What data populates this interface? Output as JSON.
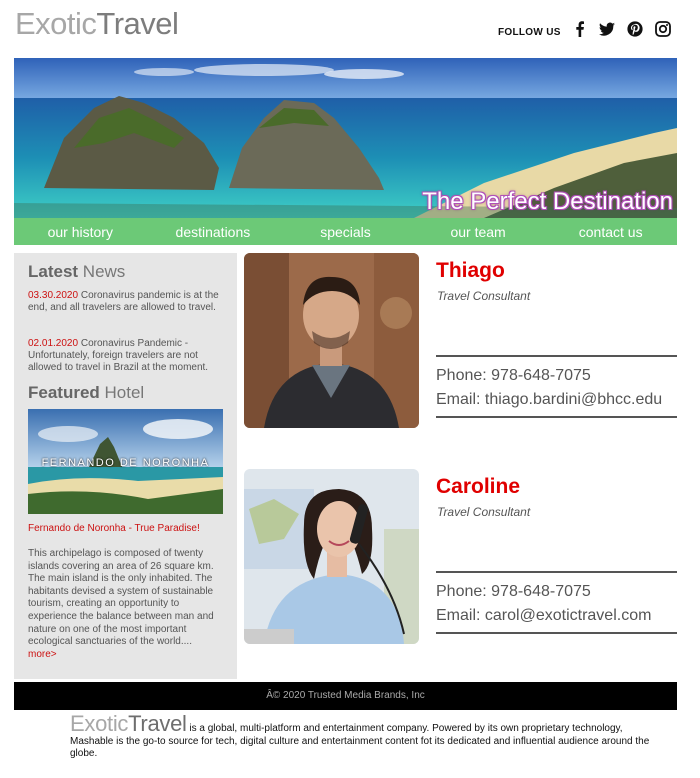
{
  "brand": {
    "logo_part1": "Exotic",
    "logo_part2": "Travel"
  },
  "header": {
    "follow_label": "FOLLOW US",
    "social": [
      {
        "icon": "facebook-icon"
      },
      {
        "icon": "twitter-icon"
      },
      {
        "icon": "pinterest-icon"
      },
      {
        "icon": "instagram-icon"
      }
    ]
  },
  "hero": {
    "caption": "The Perfect Destination"
  },
  "nav": {
    "items": [
      {
        "label": "our history"
      },
      {
        "label": "destinations"
      },
      {
        "label": "specials"
      },
      {
        "label": "our team"
      },
      {
        "label": "contact us"
      }
    ]
  },
  "sidebar": {
    "news_title_bold": "Latest",
    "news_title_rest": " News",
    "news": [
      {
        "date": "03.30.2020",
        "text": " Coronavirus pandemic is at the end, and all travelers are allowed to travel."
      },
      {
        "date": "02.01.2020",
        "text": " Coronavirus Pandemic - Unfortunately, foreign travelers are not allowed to travel in Brazil at the moment."
      }
    ],
    "featured_title_bold": "Featured",
    "featured_title_rest": " Hotel",
    "featured_image_text": "FERNANDO DE NORONHA",
    "featured_caption": "Fernando de Noronha - True Paradise!",
    "featured_body": "This archipelago is composed of twenty islands covering an area of 26 square km. The main island is the only inhabited. The habitants devised a system of sustainable tourism, creating an opportunity to experience the balance between man and nature on one of the most important ecological sanctuaries of the world....",
    "more_label": "more>"
  },
  "team": [
    {
      "name": "Thiago",
      "role": "Travel Consultant",
      "phone": "Phone: 978-648-7075",
      "email": "Email: thiago.bardini@bhcc.edu"
    },
    {
      "name": "Caroline",
      "role": "Travel Consultant",
      "phone": "Phone: 978-648-7075",
      "email": "Email: carol@exotictravel.com"
    }
  ],
  "footer": {
    "copyright": "Â© 2020 Trusted Media Brands, Inc",
    "logo_part1": "Exotic",
    "logo_part2": "Travel",
    "about": " is a global, multi-platform and entertainment company. Powered by its own proprietary technology, Mashable is the go-to source for tech, digital culture and entertainment content fot its dedicated and influential audience around the globe."
  },
  "colors": {
    "nav_green": "#6cc977",
    "accent_red": "#e00000",
    "footer_black": "#000000",
    "sidebar_gray": "#e6e6e6"
  }
}
